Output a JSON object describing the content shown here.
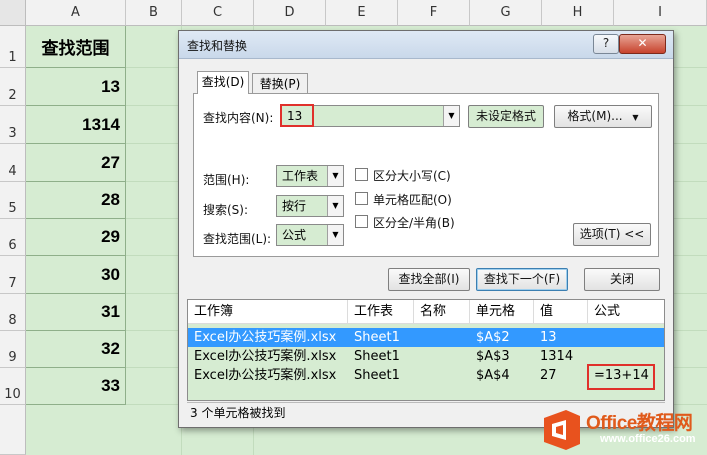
{
  "sheet": {
    "columns": [
      "A",
      "B",
      "C",
      "D",
      "E",
      "F",
      "G",
      "H",
      "I"
    ],
    "rows": [
      "1",
      "2",
      "3",
      "4",
      "5",
      "6",
      "7",
      "8",
      "9",
      "10"
    ],
    "columnA": [
      "查找范围",
      "13",
      "1314",
      "27",
      "28",
      "29",
      "30",
      "31",
      "32",
      "33"
    ]
  },
  "dialog": {
    "title": "查找和替换",
    "help": "?",
    "close": "✕",
    "tabs": {
      "find": "查找(D)",
      "replace": "替换(P)"
    },
    "find_label": "查找内容(N):",
    "find_value": "13",
    "format_status": "未设定格式",
    "format_button": "格式(M)...",
    "within_label": "范围(H):",
    "within_value": "工作表",
    "search_label": "搜索(S):",
    "search_value": "按行",
    "lookin_label": "查找范围(L):",
    "lookin_value": "公式",
    "match_case": "区分大小写(C)",
    "match_entire": "单元格匹配(O)",
    "match_width": "区分全/半角(B)",
    "options_button": "选项(T) <<",
    "find_all_button": "查找全部(I)",
    "find_next_button": "查找下一个(F)",
    "close_button": "关闭",
    "results": {
      "headers": [
        "工作簿",
        "工作表",
        "名称",
        "单元格",
        "值",
        "公式"
      ],
      "rows": [
        [
          "Excel办公技巧案例.xlsx",
          "Sheet1",
          "",
          "$A$2",
          "13",
          ""
        ],
        [
          "Excel办公技巧案例.xlsx",
          "Sheet1",
          "",
          "$A$3",
          "1314",
          ""
        ],
        [
          "Excel办公技巧案例.xlsx",
          "Sheet1",
          "",
          "$A$4",
          "27",
          "=13+14"
        ]
      ]
    },
    "status": "3 个单元格被找到"
  },
  "logo": {
    "text": "Office教程网",
    "url": "www.office26.com"
  },
  "colors": {
    "cell_green": "#d6ecd2",
    "selection_blue": "#3399ff",
    "highlight_red": "#e0302b",
    "logo_orange": "#e05a1b"
  }
}
